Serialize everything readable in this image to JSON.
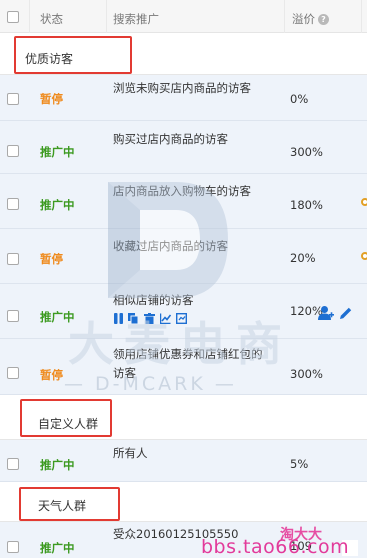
{
  "header": {
    "status": "状态",
    "search_promo": "搜索推广",
    "premium": "溢价",
    "help_icon": "question-circle-icon"
  },
  "groups": {
    "g1": "优质访客",
    "g2": "自定义人群",
    "g3": "天气人群"
  },
  "rows": [
    {
      "status": "暂停",
      "name": "浏览未购买店内商品的访客",
      "price": "0%"
    },
    {
      "status": "推广中",
      "name": "购买过店内商品的访客",
      "price": "300%"
    },
    {
      "status": "推广中",
      "name": "店内商品放入购物车的访客",
      "price": "180%"
    },
    {
      "status": "暂停",
      "name": "收藏过店内商品的访客",
      "price": "20%"
    },
    {
      "status": "推广中",
      "name": "相似店铺的访客",
      "price": "120%"
    },
    {
      "status": "暂停",
      "name_line1": "领用店铺优惠券和店铺红包的",
      "name_line2": "访客",
      "price": "300%"
    },
    {
      "status": "推广中",
      "name": "所有人",
      "price": "5%"
    },
    {
      "status": "推广中",
      "name": "受众20160125105550",
      "price": "109"
    }
  ],
  "row_actions": [
    "pause-icon",
    "copy-icon",
    "delete-icon",
    "trend-icon",
    "report-icon",
    "add-user-icon",
    "edit-icon"
  ],
  "watermark": {
    "big": "大麦电商",
    "small": "— D-MCARK —"
  },
  "footer": {
    "brand": "淘大大",
    "site": "bbs.tao66.com"
  },
  "colors": {
    "paused": "#ef8a1c",
    "running": "#3c9a20",
    "highlight": "#e23a32",
    "row_bg": "#eef3fa",
    "icon_blue": "#1e6fd2"
  }
}
